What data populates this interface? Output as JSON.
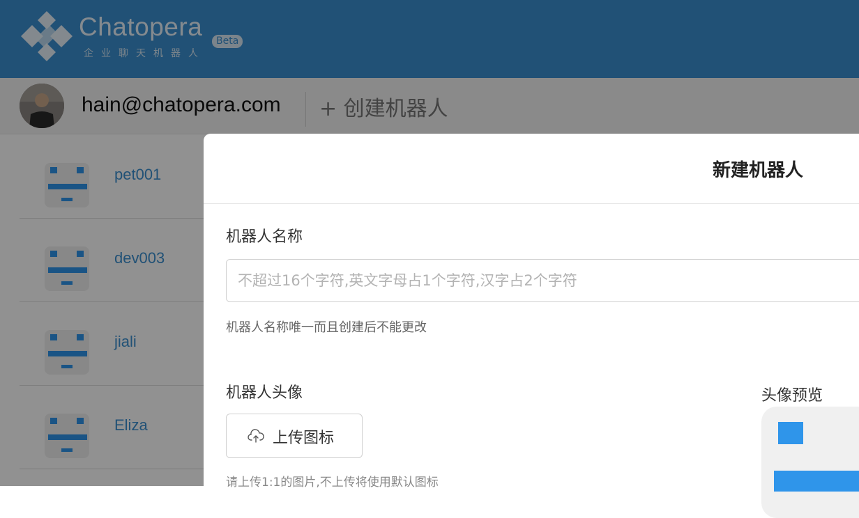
{
  "header": {
    "brand": "Chatopera",
    "tagline": "企业聊天机器人",
    "badge": "Beta",
    "color": "#3a8fcf"
  },
  "userbar": {
    "email": "hain@chatopera.com",
    "create_label": "+ 创建机器人"
  },
  "bots": [
    {
      "name": "pet001"
    },
    {
      "name": "dev003"
    },
    {
      "name": "jiali"
    },
    {
      "name": "Eliza"
    }
  ],
  "modal": {
    "title": "新建机器人",
    "name_label": "机器人名称",
    "name_placeholder": "不超过16个字符,英文字母占1个字符,汉字占2个字符",
    "name_value": "",
    "name_hint": "机器人名称唯一而且创建后不能更改",
    "avatar_label": "机器人头像",
    "upload_label": "上传图标",
    "upload_hint": "请上传1:1的图片,不上传将使用默认图标",
    "preview_label": "头像预览",
    "accent": "#2f95ea"
  }
}
